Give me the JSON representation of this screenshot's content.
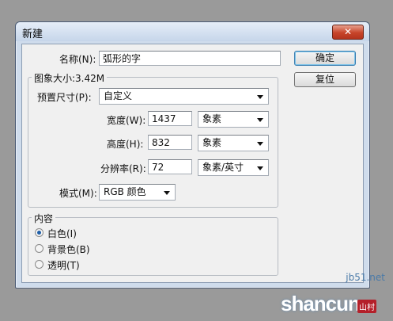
{
  "dialog": {
    "title": "新建",
    "close_label": "✕"
  },
  "form": {
    "name_label": "名称(N):",
    "name_value": "弧形的字"
  },
  "image_size": {
    "group_title": "图象大小:3.42M",
    "preset_label": "预置尺寸(P):",
    "preset_value": "自定义",
    "width_label": "宽度(W):",
    "width_value": "1437",
    "width_unit": "象素",
    "height_label": "高度(H):",
    "height_value": "832",
    "height_unit": "象素",
    "resolution_label": "分辨率(R):",
    "resolution_value": "72",
    "resolution_unit": "象素/英寸",
    "mode_label": "模式(M):",
    "mode_value": "RGB 颜色"
  },
  "contents": {
    "group_title": "内容",
    "options": [
      {
        "label": "白色(I)",
        "checked": true
      },
      {
        "label": "背景色(B)",
        "checked": false
      },
      {
        "label": "透明(T)",
        "checked": false
      }
    ]
  },
  "buttons": {
    "ok": "确定",
    "reset": "复位"
  },
  "watermark": {
    "site": "jb51.net",
    "brand": "shancun",
    "badge": "山村"
  }
}
